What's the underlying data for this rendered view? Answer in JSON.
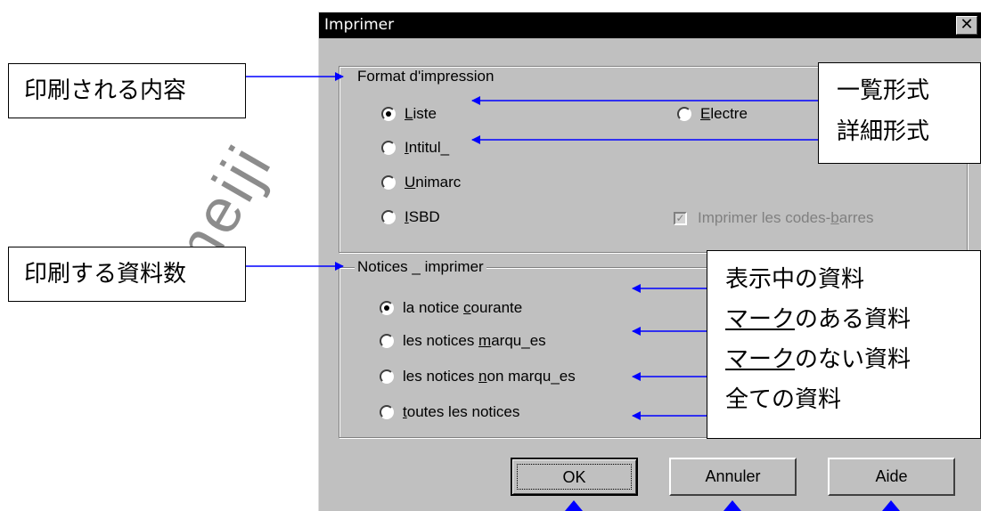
{
  "dialog": {
    "title": "Imprimer",
    "close_label": "✕",
    "format_group": {
      "legend": "Format d'impression",
      "options": [
        {
          "pre": "",
          "key": "L",
          "post": "iste",
          "checked": true
        },
        {
          "pre": "",
          "key": "E",
          "post": "lectre",
          "checked": false
        },
        {
          "pre": "",
          "key": "I",
          "post": "ntitul_",
          "checked": false
        },
        {
          "pre": "",
          "key": "U",
          "post": "nimarc",
          "checked": false
        },
        {
          "pre": "",
          "key": "I",
          "post": "SBD",
          "checked": false
        }
      ],
      "barcode": {
        "pre": "Imprimer les codes-",
        "key": "b",
        "post": "arres",
        "checked": true,
        "enabled": false
      }
    },
    "notices_group": {
      "legend": "Notices _ imprimer",
      "options": [
        {
          "pre": "la notice ",
          "key": "c",
          "post": "ourante",
          "checked": true
        },
        {
          "pre": "les notices ",
          "key": "m",
          "post": "arqu_es",
          "checked": false
        },
        {
          "pre": "les notices ",
          "key": "n",
          "post": "on marqu_es",
          "checked": false
        },
        {
          "pre": "",
          "key": "t",
          "post": "outes les notices",
          "checked": false
        }
      ]
    },
    "buttons": {
      "ok": "OK",
      "cancel": "Annuler",
      "help": "Aide"
    }
  },
  "callouts": {
    "printed_content": "印刷される内容",
    "print_count": "印刷する資料数",
    "list_format": "一覧形式",
    "detail_format": "詳細形式",
    "displayed": "表示中の資料",
    "marked_underlined": "マーク",
    "marked_rest": "のある資料",
    "unmarked_underlined": "マーク",
    "unmarked_rest": "のない資料",
    "all": "全ての資料"
  },
  "watermark": "meiji",
  "colors": {
    "arrow": "#0000ff",
    "dialog_bg": "#c0c0c0",
    "title_bg": "#000000"
  }
}
